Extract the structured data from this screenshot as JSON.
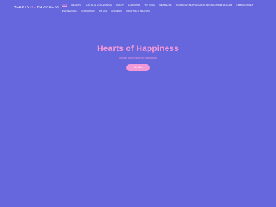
{
  "site": {
    "logo_main": "HEARTS",
    "logo_accent": "OF",
    "logo_end": "HAPPINESS"
  },
  "nav": {
    "items": [
      {
        "label": "Hem",
        "active": true
      },
      {
        "label": "Healing"
      },
      {
        "label": "Själslig Vägledning"
      },
      {
        "label": "Kraft"
      },
      {
        "label": "Hårkonst"
      },
      {
        "label": "Yin Yoga"
      },
      {
        "label": "Retreats"
      },
      {
        "label": "Guidningstext & Chrakreningstimeflaggar"
      },
      {
        "label": "Erbjudanden"
      },
      {
        "label": "Evenemang"
      },
      {
        "label": "Kontakter"
      },
      {
        "label": "Om Mig"
      },
      {
        "label": "Biografi"
      },
      {
        "label": "Praktiska Träning"
      }
    ]
  },
  "hero": {
    "title": "Hearts of Happiness",
    "subtitle": "Andlig och personlig utveckling",
    "button_label": "Läs Mer"
  },
  "colors": {
    "background": "#6666dd",
    "accent": "#f29ad8",
    "text": "#ffffff"
  }
}
